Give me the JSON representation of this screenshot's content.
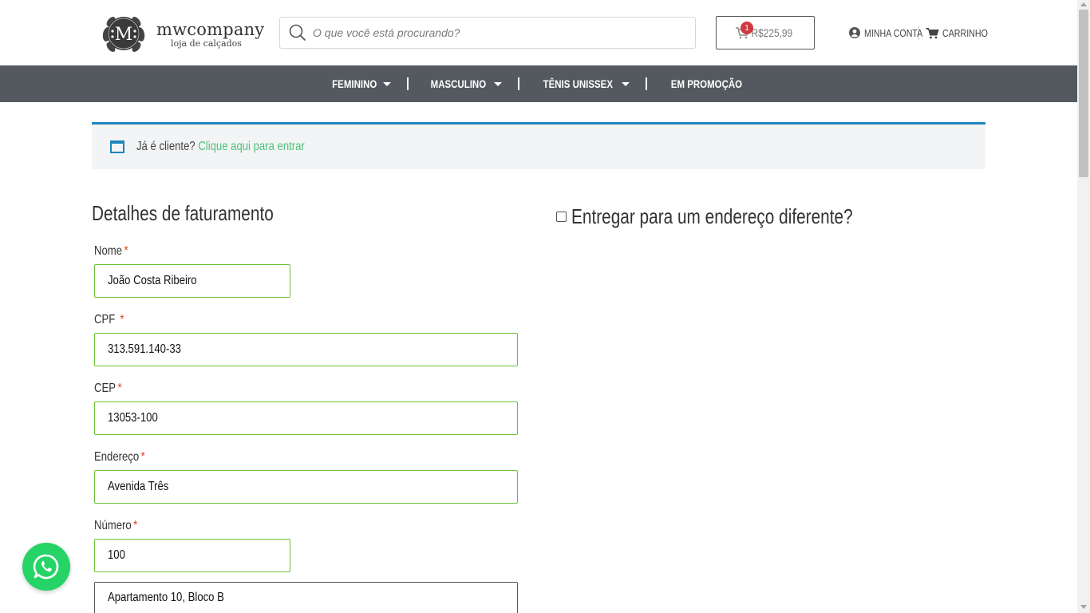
{
  "header": {
    "logo": {
      "letter": "M",
      "name": "mwcompany",
      "subtitle": "loja de calçados"
    },
    "search": {
      "placeholder": "O que você está procurando?"
    },
    "cart": {
      "count": "1",
      "total": "R$225,99"
    },
    "links": {
      "account": "MINHA CONTA",
      "cart": "CARRINHO"
    }
  },
  "nav": {
    "items": [
      {
        "label": "FEMININO",
        "has_dropdown": true
      },
      {
        "label": "MASCULINO",
        "has_dropdown": true
      },
      {
        "label": "TÊNIS UNISSEX",
        "has_dropdown": true
      },
      {
        "label": "EM PROMOÇÃO",
        "has_dropdown": false
      }
    ]
  },
  "notice": {
    "text": "Já é cliente?",
    "link": "Clique aqui para entrar"
  },
  "billing": {
    "title": "Detalhes de faturamento",
    "fields": {
      "nome": {
        "label": "Nome",
        "required": "*",
        "value": "João Costa Ribeiro"
      },
      "cpf": {
        "label": "CPF ",
        "required": "*",
        "value": "313.591.140-33"
      },
      "cep": {
        "label": "CEP",
        "required": "*",
        "value": "13053-100"
      },
      "endereco": {
        "label": "Endereço",
        "required": "*",
        "value": "Avenida Três"
      },
      "numero": {
        "label": "Número",
        "required": "*",
        "value": "100"
      },
      "complemento": {
        "value": "Apartamento 10, Bloco B"
      }
    }
  },
  "shipping": {
    "toggle_label": "Entregar para um endereço diferente?"
  },
  "colors": {
    "nav_bg": "#54595f",
    "notice_border": "#1e85be",
    "link_green": "#4ec17b",
    "field_border_valid": "#6fbf3a",
    "required_red": "#e2401c",
    "whatsapp_green": "#25d366",
    "cart_badge": "#d0393e"
  },
  "icons": [
    "search-icon",
    "cart-icon",
    "user-circle-icon",
    "window-icon",
    "whatsapp-icon",
    "chevron-down-icon"
  ]
}
